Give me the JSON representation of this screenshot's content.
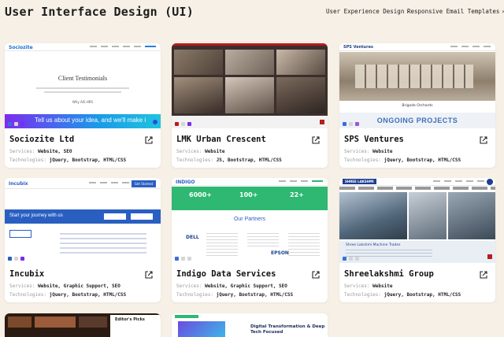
{
  "header": {
    "title": "User Interface Design (UI)",
    "nav": [
      {
        "label": "User Experience Design",
        "chevron": "›"
      },
      {
        "label": "Responsive Email Templates",
        "chevron": "›"
      }
    ]
  },
  "labels": {
    "services": "Services:",
    "technologies": "Technologies:"
  },
  "cards": [
    {
      "title": "Sociozite Ltd",
      "services": "Website, SEO",
      "technologies": "jQuery, Bootstrap, HTML/CSS",
      "thumb": {
        "logo": "Sociozite",
        "heading": "Client Testimonials",
        "contact": "Why AIS HRS",
        "banner": "Tell us about your idea, and we'll make i"
      }
    },
    {
      "title": "LMK Urban Crescent",
      "services": "Website",
      "technologies": "JS, Bootstrap, HTML/CSS"
    },
    {
      "title": "SPS Ventures",
      "services": "Website",
      "technologies": "jQuery, Bootstrap, HTML/CSS",
      "thumb": {
        "logo": "SPS Ventures",
        "caption": "Brigade Orchards",
        "section": "ONGOING PROJECTS"
      }
    },
    {
      "title": "Incubix",
      "services": "Website, Graphic Support, SEO",
      "technologies": "jQuery, Bootstrap, HTML/CSS",
      "thumb": {
        "logo": "Incubix",
        "cta_button": "Get Started",
        "banner": "Start your journey with us"
      }
    },
    {
      "title": "Indigo Data Services",
      "services": "Website, Graphic Support, SEO",
      "technologies": "jQuery, Bootstrap, HTML/CSS",
      "thumb": {
        "logo": "INDIGO",
        "stat1": "6000+",
        "stat2": "100+",
        "stat3": "22+",
        "heading": "Our Partners",
        "partners": [
          "DELL",
          "EPSON"
        ]
      }
    },
    {
      "title": "Shreelakshmi Group",
      "services": "Website",
      "technologies": "jQuery, Bootstrap, HTML/CSS",
      "thumb": {
        "logo": "SHREE LAKSHMI",
        "caption": "Shree Lakshmi Machine Trades"
      }
    }
  ],
  "partial_cards": {
    "picks": "Editor's Picks",
    "digital": "Digital Transformation & Deep Tech Focused"
  },
  "colors": {
    "page_bg": "#f6f0e6",
    "card_bg": "#ffffff",
    "sociozite_banner": "#1a9be8",
    "lmk_border": "#b71c1c",
    "indigo_green": "#2eb872",
    "incubix_blue": "#2a5fc2"
  }
}
